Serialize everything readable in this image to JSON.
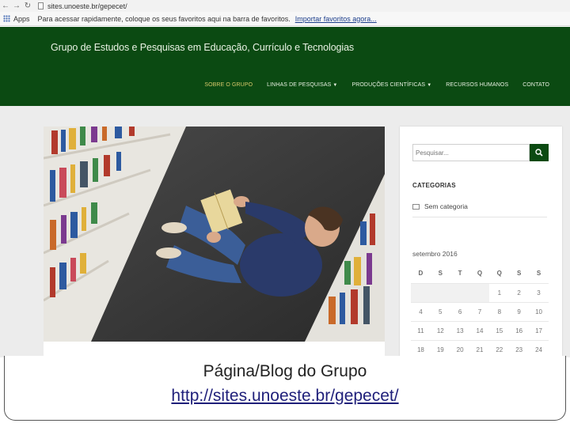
{
  "browser": {
    "url": "sites.unoeste.br/gepecet/",
    "apps_label": "Apps",
    "bookmarks_hint": "Para acessar rapidamente, coloque os seus favoritos aqui na barra de favoritos.",
    "import_link": "Importar favoritos agora..."
  },
  "site": {
    "title": "Grupo de Estudos e Pesquisas em Educação, Currículo e Tecnologias",
    "nav": [
      {
        "label": "SOBRE O GRUPO",
        "active": true
      },
      {
        "label": "LINHAS DE PESQUISAS",
        "dropdown": true
      },
      {
        "label": "PRODUÇÕES CIENTÍFICAS",
        "dropdown": true
      },
      {
        "label": "RECURSOS HUMANOS"
      },
      {
        "label": "CONTATO"
      }
    ],
    "colors": {
      "header": "#0b4a12",
      "active_nav": "#d7c86a"
    }
  },
  "sidebar": {
    "search_placeholder": "Pesquisar...",
    "categories_heading": "CATEGORIAS",
    "category": "Sem categoria",
    "calendar_title": "setembro 2016",
    "weekdays": [
      "D",
      "S",
      "T",
      "Q",
      "Q",
      "S",
      "S"
    ],
    "rows": [
      [
        "",
        "",
        "",
        "",
        "1",
        "2",
        "3"
      ],
      [
        "4",
        "5",
        "6",
        "7",
        "8",
        "9",
        "10"
      ],
      [
        "11",
        "12",
        "13",
        "14",
        "15",
        "16",
        "17"
      ],
      [
        "18",
        "19",
        "20",
        "21",
        "22",
        "23",
        "24"
      ]
    ]
  },
  "caption": {
    "title": "Página/Blog do Grupo",
    "url": "http://sites.unoeste.br/gepecet/"
  }
}
